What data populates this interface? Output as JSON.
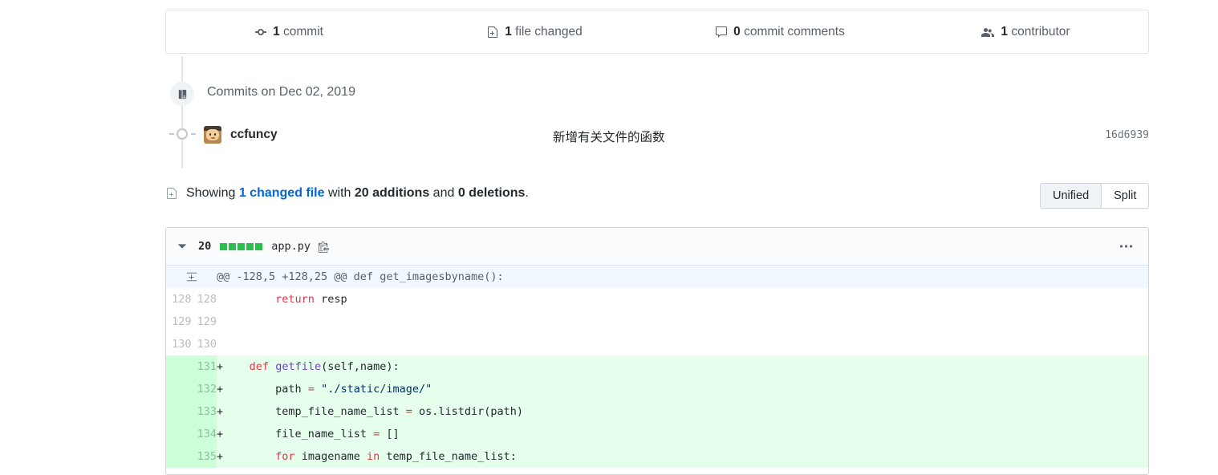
{
  "summary": {
    "items": [
      {
        "icon": "commit-icon",
        "count": "1",
        "label": " commit"
      },
      {
        "icon": "file-diff-icon",
        "count": "1",
        "label": " file changed"
      },
      {
        "icon": "comment-icon",
        "count": "0",
        "label": " commit comments"
      },
      {
        "icon": "contributors-icon",
        "count": "1",
        "label": " contributor"
      }
    ]
  },
  "timeline": {
    "date_label": "Commits on Dec 02, 2019",
    "commit": {
      "author": "ccfuncy",
      "message": "新增有关文件的函数",
      "sha": "16d6939"
    }
  },
  "showing": {
    "prefix": "Showing ",
    "changed_file": "1 changed file",
    "mid": " with ",
    "additions": "20 additions",
    "and": " and ",
    "deletions": "0 deletions",
    "period": ".",
    "toggle": {
      "unified": "Unified",
      "split": "Split",
      "selected": "Unified"
    }
  },
  "file": {
    "additions_count": "20",
    "name": "app.py",
    "diffstat_blocks": 5,
    "diffstat_color": "#2cbe4e",
    "hunk_header": "@@ -128,5 +128,25 @@ def get_imagesbyname():",
    "rows": [
      {
        "type": "hunk",
        "old": "",
        "new": "",
        "marker": "",
        "tokens": [
          {
            "t": "@@ -128,5 +128,25 @@ def get_imagesbyname():",
            "c": "n"
          }
        ]
      },
      {
        "type": "ctx",
        "old": "128",
        "new": "128",
        "marker": "",
        "tokens": [
          {
            "t": "        ",
            "c": "n"
          },
          {
            "t": "return",
            "c": "k"
          },
          {
            "t": " resp",
            "c": "n"
          }
        ]
      },
      {
        "type": "ctx",
        "old": "129",
        "new": "129",
        "marker": "",
        "tokens": [
          {
            "t": "",
            "c": "n"
          }
        ]
      },
      {
        "type": "ctx",
        "old": "130",
        "new": "130",
        "marker": "",
        "tokens": [
          {
            "t": "",
            "c": "n"
          }
        ]
      },
      {
        "type": "add",
        "old": "",
        "new": "131",
        "marker": "+",
        "tokens": [
          {
            "t": "    ",
            "c": "n"
          },
          {
            "t": "def",
            "c": "k"
          },
          {
            "t": " ",
            "c": "n"
          },
          {
            "t": "getfile",
            "c": "fn"
          },
          {
            "t": "(self,name):",
            "c": "n"
          }
        ]
      },
      {
        "type": "add",
        "old": "",
        "new": "132",
        "marker": "+",
        "tokens": [
          {
            "t": "        path ",
            "c": "n"
          },
          {
            "t": "=",
            "c": "op"
          },
          {
            "t": " ",
            "c": "n"
          },
          {
            "t": "\"./static/image/\"",
            "c": "s"
          }
        ]
      },
      {
        "type": "add",
        "old": "",
        "new": "133",
        "marker": "+",
        "tokens": [
          {
            "t": "        temp_file_name_list ",
            "c": "n"
          },
          {
            "t": "=",
            "c": "op"
          },
          {
            "t": " os.listdir(path)",
            "c": "n"
          }
        ]
      },
      {
        "type": "add",
        "old": "",
        "new": "134",
        "marker": "+",
        "tokens": [
          {
            "t": "        file_name_list ",
            "c": "n"
          },
          {
            "t": "=",
            "c": "op"
          },
          {
            "t": " []",
            "c": "n"
          }
        ]
      },
      {
        "type": "add",
        "old": "",
        "new": "135",
        "marker": "+",
        "tokens": [
          {
            "t": "        ",
            "c": "n"
          },
          {
            "t": "for",
            "c": "k"
          },
          {
            "t": " imagename ",
            "c": "n"
          },
          {
            "t": "in",
            "c": "k"
          },
          {
            "t": " temp_file_name_list:",
            "c": "n"
          }
        ]
      }
    ]
  }
}
